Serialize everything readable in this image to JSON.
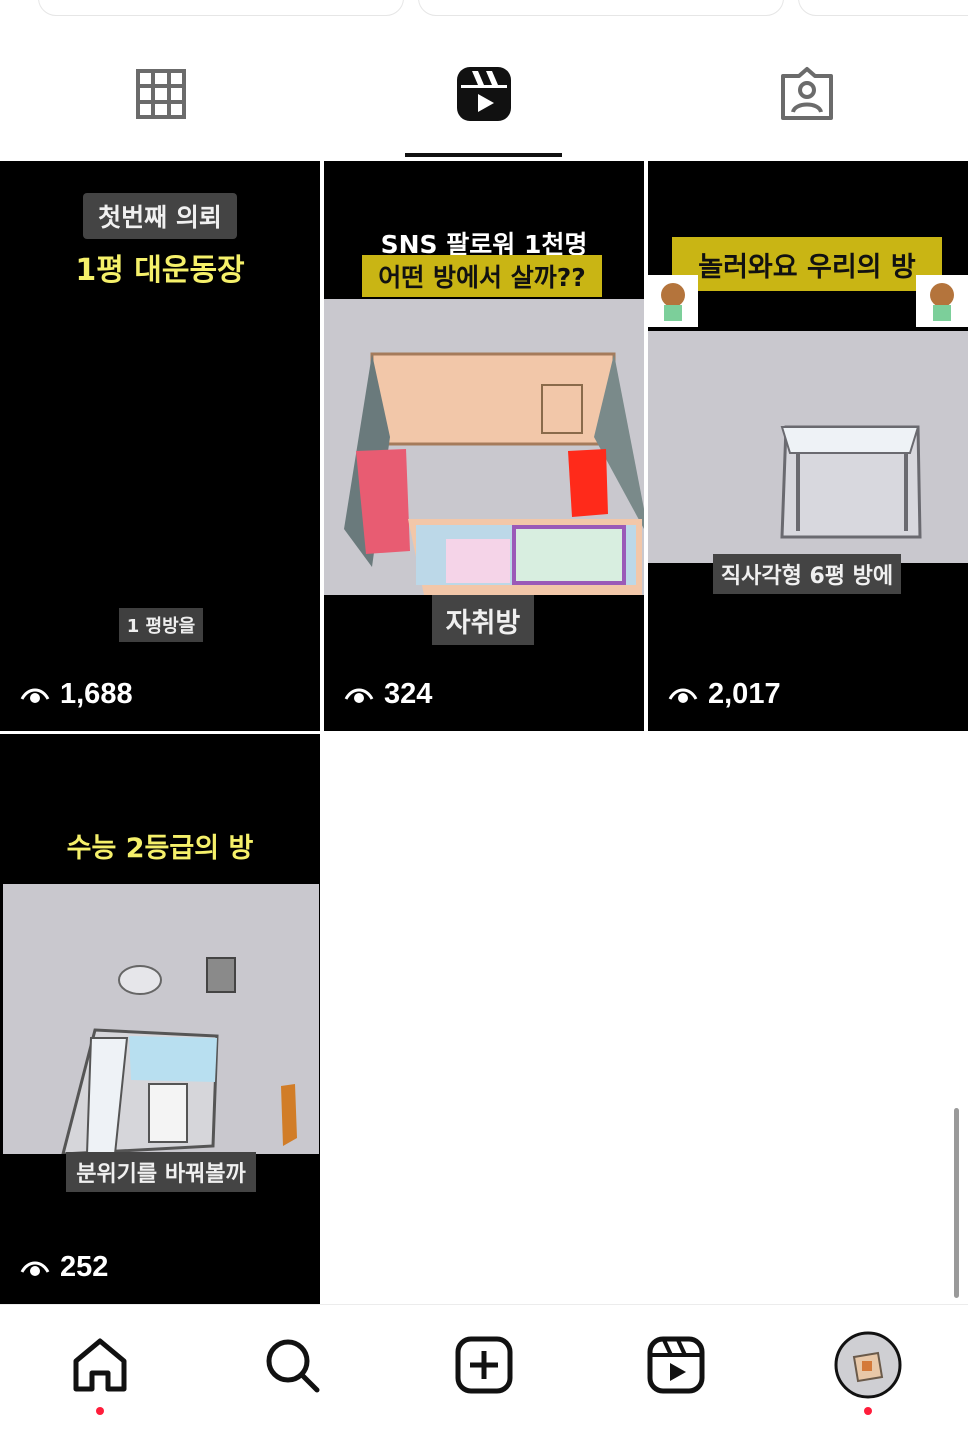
{
  "tabs": {
    "active": "reels",
    "items": [
      {
        "name": "posts-grid",
        "icon": "grid-icon"
      },
      {
        "name": "reels",
        "icon": "reels-icon"
      },
      {
        "name": "tagged",
        "icon": "tagged-person-icon"
      }
    ]
  },
  "reels": [
    {
      "top_caption_1": "첫번째 의뢰",
      "top_caption_2": "1평 대운동장",
      "bottom_caption": "1 평방을",
      "views": "1,688"
    },
    {
      "top_caption_1": "SNS 팔로워 1천명",
      "top_caption_2": "어떤 방에서 살까??",
      "bottom_caption": "자취방",
      "views": "324"
    },
    {
      "top_caption_1": "놀러와요 우리의 방",
      "bottom_caption": "직사각형 6평 방에",
      "views": "2,017"
    },
    {
      "top_caption_1": "수능 2등급의 방",
      "bottom_caption": "분위기를 바꿔볼까",
      "views": "252"
    }
  ],
  "bottom_nav": [
    {
      "name": "home",
      "icon": "home-icon",
      "notification_dot": true
    },
    {
      "name": "search",
      "icon": "search-icon",
      "notification_dot": false
    },
    {
      "name": "create",
      "icon": "plus-square-icon",
      "notification_dot": false
    },
    {
      "name": "reels",
      "icon": "reels-icon",
      "notification_dot": false
    },
    {
      "name": "profile",
      "icon": "profile-avatar",
      "notification_dot": true
    }
  ],
  "colors": {
    "accent_dot": "#ff1d3b",
    "caption_yellow": "#f5f06a",
    "caption_highlight": "#c9b514"
  }
}
